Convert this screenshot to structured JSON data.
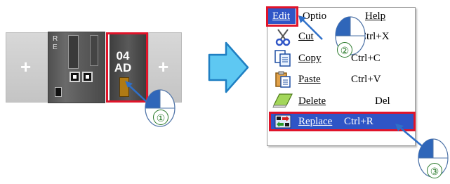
{
  "rack": {
    "plus_left": "+",
    "plus_right": "+",
    "cpu_letters": [
      "R",
      "E"
    ],
    "module_code_line1": "04",
    "module_code_line2": "AD"
  },
  "menu": {
    "bar": {
      "edit": "Edit",
      "options": "Options",
      "help": "Help"
    },
    "items": [
      {
        "label": "Cut",
        "shortcut": "Ctrl+X",
        "icon": "scissors-icon"
      },
      {
        "label": "Copy",
        "shortcut": "Ctrl+C",
        "icon": "copy-icon"
      },
      {
        "label": "Paste",
        "shortcut": "Ctrl+V",
        "icon": "paste-icon"
      },
      {
        "label": "Delete",
        "shortcut": "Del",
        "icon": "eraser-icon"
      },
      {
        "label": "Replace",
        "shortcut": "Ctrl+R",
        "icon": "replace-icon"
      }
    ]
  },
  "markers": {
    "step1": "①",
    "step2": "②",
    "step3": "③"
  },
  "colors": {
    "highlight_box": "#e0142a",
    "selection": "#2f55c6",
    "arrow_fill": "#5ec8f2",
    "marker_number": "#2a7a2a"
  }
}
